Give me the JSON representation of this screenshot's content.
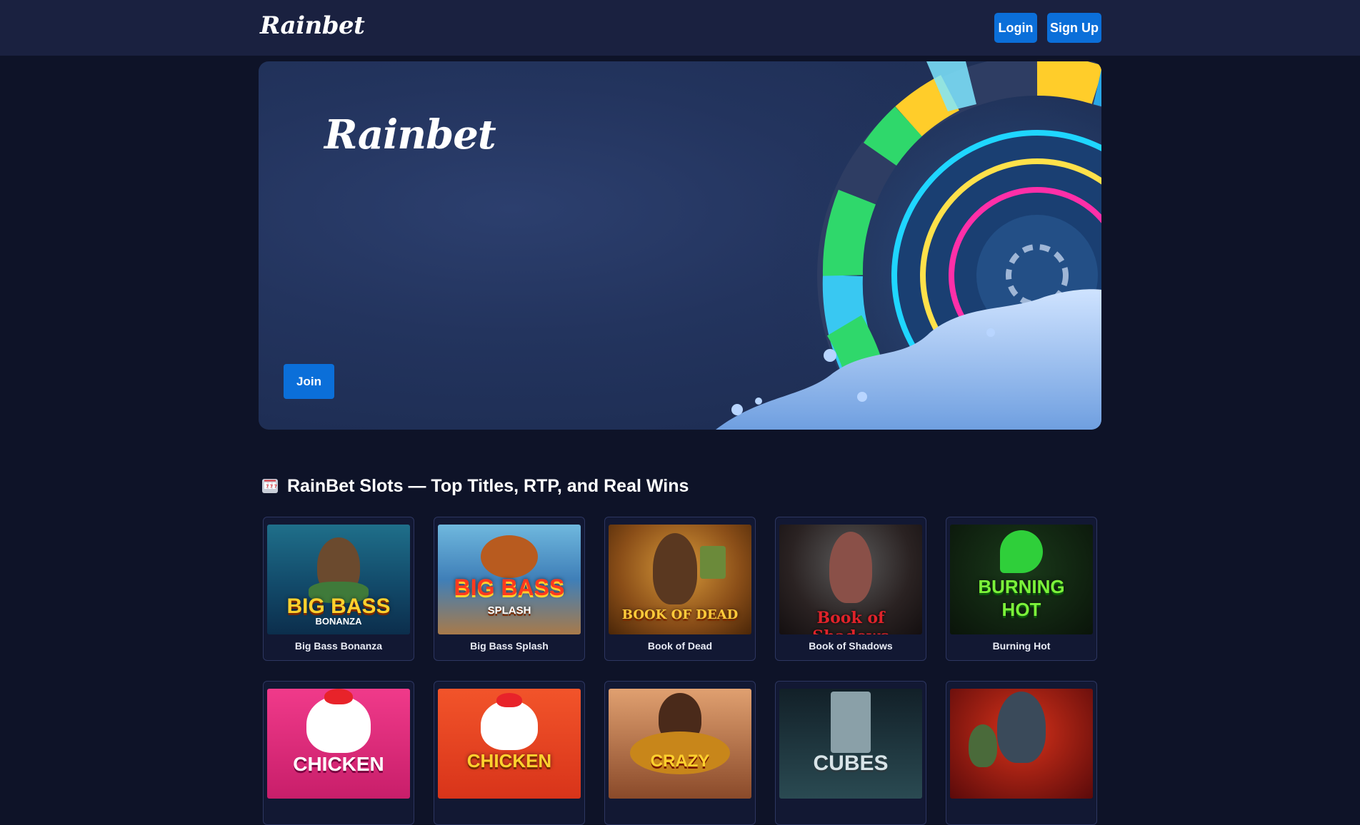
{
  "header": {
    "logo_text": "Rainbet",
    "login_label": "Login",
    "signup_label": "Sign Up"
  },
  "hero": {
    "logo_text": "Rainbet",
    "join_label": "Join"
  },
  "section": {
    "icon": "slot-machine-icon",
    "title": "RainBet Slots — Top Titles, RTP, and Real Wins"
  },
  "games": [
    {
      "name": "Big Bass Bonanza",
      "art_title": "BIG BASS",
      "art_sub": "BONANZA"
    },
    {
      "name": "Big Bass Splash",
      "art_title": "BIG BASS",
      "art_sub": "SPLASH"
    },
    {
      "name": "Book of Dead",
      "art_title": "BOOK OF DEAD",
      "art_sub": ""
    },
    {
      "name": "Book of Shadows",
      "art_title": "Book of Shadows",
      "art_sub": ""
    },
    {
      "name": "Burning Hot",
      "art_title": "BURNING",
      "art_sub": "HOT"
    },
    {
      "name": "",
      "art_title": "CHICKEN",
      "art_sub": ""
    },
    {
      "name": "",
      "art_title": "CHICKEN",
      "art_sub": ""
    },
    {
      "name": "",
      "art_title": "CRAZY",
      "art_sub": ""
    },
    {
      "name": "",
      "art_title": "CUBES",
      "art_sub": ""
    },
    {
      "name": "",
      "art_title": "",
      "art_sub": ""
    }
  ],
  "colors": {
    "page_bg": "#0e1328",
    "header_bg": "#1a2140",
    "accent_button": "#0b6fd9",
    "card_bg": "#121833",
    "card_border": "#2d3660"
  }
}
